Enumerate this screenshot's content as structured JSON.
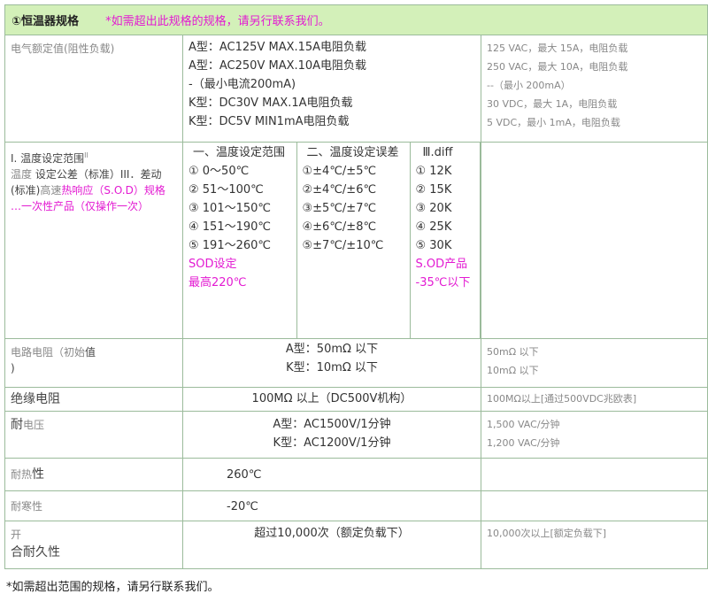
{
  "header": {
    "title": "①恒温器规格",
    "note": "*如需超出此规格的规格，请另行联系我们。"
  },
  "rows": {
    "rating": {
      "label": "电气额定值(阻性负载)",
      "mid": [
        "A型：AC125V MAX.15A电阻负载",
        "A型：AC250V MAX.10A电阻负载",
        "-（最小电流200mA)",
        "K型：DC30V MAX.1A电阻负载",
        "K型：DC5V MIN1mA电阻负载"
      ],
      "right": [
        "125 VAC，最大 15A，电阻负载",
        "250 VAC，最大 10A，电阻负载",
        "--（最小 200mA）",
        "30 VDC，最大 1A，电阻负载",
        "5 VDC，最小 1mA，电阻负载"
      ]
    },
    "temp": {
      "label_1": "I. 温度设定范围",
      "label_1_sup": "II",
      "label_2": "温度",
      "label_3": "设定公差（标准）III．差动",
      "label_4": "(标准)",
      "label_5": "高速",
      "label_6": "热响应（S.O.D）规格",
      "label_7": "…一次性产品（仅操作一次）",
      "col1_head": "一、温度设定范围",
      "col1": [
        "① 0～50℃",
        "② 51～100℃",
        "③ 101～150℃",
        "④ 151～190℃",
        "⑤ 191～260℃"
      ],
      "col1_sod": [
        "SOD设定",
        "最高220℃"
      ],
      "col2_head": "二、温度设定误差",
      "col2": [
        "①±4℃/±5℃",
        "②±4℃/±6℃",
        "③±5℃/±7℃",
        "④±6℃/±8℃",
        "⑤±7℃/±10℃"
      ],
      "col3_head": "Ⅲ.diff",
      "col3": [
        "① 12K",
        "② 15K",
        "③ 20K",
        "④ 25K",
        "⑤ 30K"
      ],
      "col3_sod": [
        "S.OD产品",
        "-35℃以下"
      ]
    },
    "resistance": {
      "label_1": "电路电阻（初始",
      "label_2": "值",
      "label_3": ")",
      "mid": [
        "A型：50mΩ 以下",
        "K型：10mΩ 以下"
      ],
      "right": [
        "50mΩ 以下",
        "10mΩ 以下"
      ]
    },
    "insulation": {
      "label": "绝缘电阻",
      "mid": "100MΩ 以上（DC500V机构）",
      "right": "100MΩ以上[通过500VDC兆欧表]"
    },
    "voltage": {
      "label_1": "耐",
      "label_2": "电压",
      "mid": [
        "A型：AC1500V/1分钟",
        "K型：AC1200V/1分钟"
      ],
      "right": [
        "1,500 VAC/分钟",
        "1,200 VAC/分钟"
      ]
    },
    "heat": {
      "label_1": "耐热",
      "label_2": "性",
      "mid": "260℃"
    },
    "cold": {
      "label": "耐寒性",
      "mid": "-20℃"
    },
    "durability": {
      "label_1": "开",
      "label_2": "合耐久性",
      "mid": "超过10,000次（额定负载下）",
      "right": "10,000次以上[额定负载下]"
    }
  },
  "footnote": "*如需超出范围的规格，请另行联系我们。"
}
